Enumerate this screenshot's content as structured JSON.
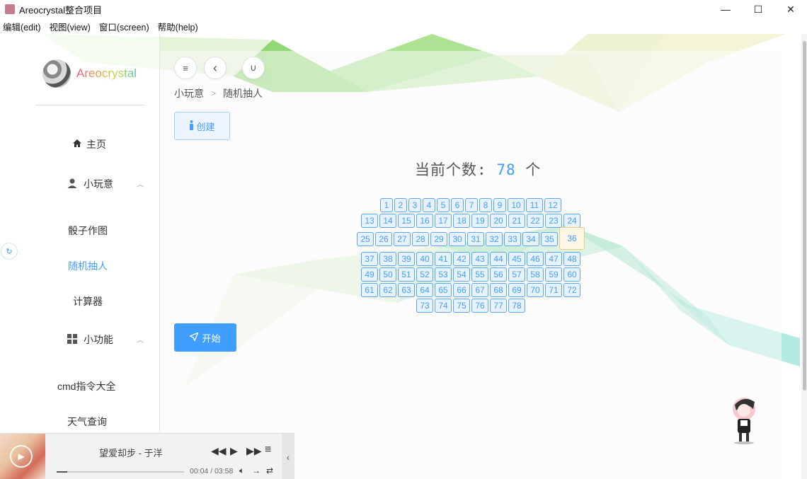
{
  "window": {
    "title": "Areocrystal整合项目",
    "minimize": "—",
    "maximize": "☐",
    "close": "✕"
  },
  "menu": [
    "编辑(edit)",
    "视图(view)",
    "窗口(screen)",
    "帮助(help)"
  ],
  "sidebar": {
    "logo_text": "Areocrystal",
    "items": [
      {
        "label": "主页",
        "icon": "home-icon"
      },
      {
        "label": "小玩意",
        "icon": "user-icon"
      },
      {
        "label": "骰子作图"
      },
      {
        "label": "随机抽人",
        "active": true
      },
      {
        "label": "计算器"
      },
      {
        "label": "小功能",
        "icon": "grid-icon"
      },
      {
        "label": "cmd指令大全"
      },
      {
        "label": "天气查询"
      }
    ]
  },
  "toolbar": {
    "menu_icon": "≡",
    "back_icon": "‹",
    "magnet_icon": "∪"
  },
  "breadcrumb": {
    "parent": "小玩意",
    "current": "随机抽人"
  },
  "create_button": "创建",
  "start_button": "开始",
  "counter": {
    "prefix": "当前个数:",
    "value": "78",
    "suffix": "个"
  },
  "tags": {
    "rows": [
      [
        "1",
        "2",
        "3",
        "4",
        "5",
        "6",
        "7",
        "8",
        "9",
        "10",
        "11",
        "12"
      ],
      [
        "13",
        "14",
        "15",
        "16",
        "17",
        "18",
        "19",
        "20",
        "21",
        "22",
        "23",
        "24"
      ],
      [
        "25",
        "26",
        "27",
        "28",
        "29",
        "30",
        "31",
        "32",
        "33",
        "34",
        "35",
        "36"
      ],
      [
        "37",
        "38",
        "39",
        "40",
        "41",
        "42",
        "43",
        "44",
        "45",
        "46",
        "47",
        "48"
      ],
      [
        "49",
        "50",
        "51",
        "52",
        "53",
        "54",
        "55",
        "56",
        "57",
        "58",
        "59",
        "60"
      ],
      [
        "61",
        "62",
        "63",
        "64",
        "65",
        "66",
        "67",
        "68",
        "69",
        "70",
        "71",
        "72"
      ],
      [
        "73",
        "74",
        "75",
        "76",
        "77",
        "78"
      ]
    ],
    "highlighted": "36"
  },
  "player": {
    "song": "望爱却步 - 于洋",
    "time": "00:04 / 03:58",
    "progress": 0.017
  }
}
